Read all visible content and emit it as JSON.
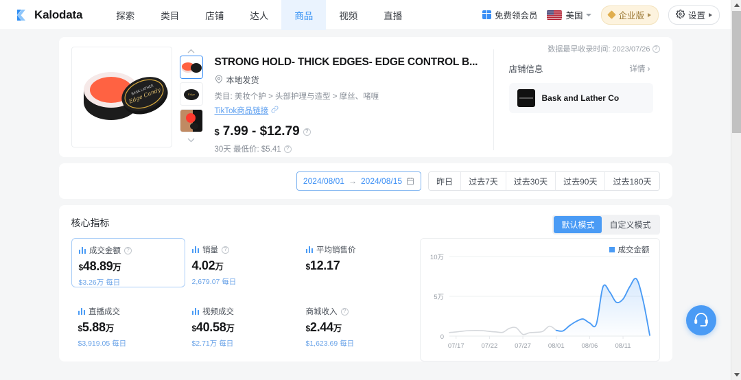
{
  "nav": {
    "brand": "Kalodata",
    "items": [
      {
        "label": "探索",
        "active": false
      },
      {
        "label": "类目",
        "active": false
      },
      {
        "label": "店铺",
        "active": false
      },
      {
        "label": "达人",
        "active": false
      },
      {
        "label": "商品",
        "active": true
      },
      {
        "label": "视频",
        "active": false
      },
      {
        "label": "直播",
        "active": false
      }
    ],
    "free_member": "免费领会员",
    "country": "美国",
    "enterprise": "企业版",
    "settings": "设置"
  },
  "product": {
    "stamp_label": "数据最早收录时间: 2023/07/26",
    "title": "STRONG HOLD- THICK EDGES- EDGE CONTROL B...",
    "shipping": "本地发货",
    "category": "类目: 美妆个护 > 头部护理与造型 > 摩丝、啫喱",
    "tiktok_link": "TikTok商品链接",
    "price": "$7.99 - $12.79",
    "price_currency": "$",
    "price_body": "7.99 - $12.79",
    "lowest": "30天 最低价: $5.41"
  },
  "shop": {
    "heading": "店铺信息",
    "more": "详情 ›",
    "name": "Bask and Lather Co"
  },
  "daterange": {
    "start": "2024/08/01",
    "arrow": "→",
    "end": "2024/08/15",
    "presets": [
      "昨日",
      "过去7天",
      "过去30天",
      "过去90天",
      "过去180天"
    ]
  },
  "metrics": {
    "heading": "核心指标",
    "modes": [
      {
        "label": "默认模式",
        "active": true
      },
      {
        "label": "自定义模式",
        "active": false
      }
    ],
    "cells": [
      {
        "label": "成交金额",
        "has_icon": true,
        "has_help": true,
        "currency": "$",
        "value": "48.89",
        "unit": "万",
        "sub": "$3.26万 每日",
        "highlight": true
      },
      {
        "label": "销量",
        "has_icon": true,
        "has_help": true,
        "currency": "",
        "value": "4.02",
        "unit": "万",
        "sub": "2,679.07 每日",
        "highlight": false
      },
      {
        "label": "平均销售价",
        "has_icon": true,
        "has_help": false,
        "currency": "$",
        "value": "12.17",
        "unit": "",
        "sub": "",
        "highlight": false
      },
      {
        "label": "直播成交",
        "has_icon": true,
        "has_help": false,
        "currency": "$",
        "value": "5.88",
        "unit": "万",
        "sub": "$3,919.05 每日",
        "highlight": false
      },
      {
        "label": "视频成交",
        "has_icon": true,
        "has_help": false,
        "currency": "$",
        "value": "40.58",
        "unit": "万",
        "sub": "$2.71万 每日",
        "highlight": false
      },
      {
        "label": "商城收入",
        "has_icon": false,
        "has_help": true,
        "currency": "$",
        "value": "2.44",
        "unit": "万",
        "sub": "$1,623.69 每日",
        "highlight": false
      }
    ]
  },
  "chart_data": {
    "type": "area",
    "title": "",
    "legend": [
      "成交金额"
    ],
    "legend_position": "top-right",
    "xlabel": "",
    "ylabel": "",
    "grid": true,
    "ylim": [
      0,
      100000
    ],
    "ytick_labels": [
      "0",
      "5万",
      "10万"
    ],
    "ytick_values": [
      0,
      50000,
      100000
    ],
    "xtick_labels": [
      "07/17",
      "07/22",
      "07/27",
      "08/01",
      "08/06",
      "08/11"
    ],
    "accent_color": "#4a9bf5",
    "muted_color": "#d4d7db",
    "series": [
      {
        "name": "成交金额",
        "x": [
          "07/16",
          "07/17",
          "07/18",
          "07/19",
          "07/20",
          "07/21",
          "07/22",
          "07/23",
          "07/24",
          "07/25",
          "07/26",
          "07/27",
          "07/28",
          "07/29",
          "07/30",
          "07/31",
          "08/01",
          "08/02",
          "08/03",
          "08/04",
          "08/05",
          "08/06",
          "08/07",
          "08/08",
          "08/09",
          "08/10",
          "08/11",
          "08/12",
          "08/13",
          "08/14",
          "08/15"
        ],
        "values": [
          4500,
          5200,
          6200,
          6900,
          7100,
          6800,
          5900,
          5200,
          4800,
          9800,
          10500,
          2200,
          4200,
          4800,
          6000,
          12500,
          7200,
          6500,
          13200,
          18500,
          21500,
          16500,
          15000,
          62000,
          55500,
          42500,
          46500,
          62000,
          72000,
          45000,
          1000
        ],
        "muted_until_index": 16
      }
    ]
  },
  "fab": {
    "icon": "headset-icon"
  }
}
